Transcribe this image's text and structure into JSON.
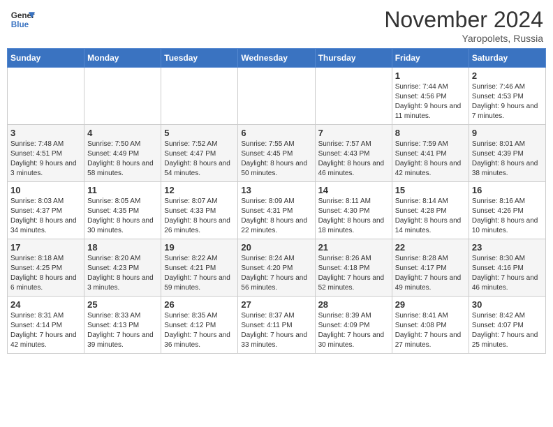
{
  "header": {
    "logo_text_general": "General",
    "logo_text_blue": "Blue",
    "month_title": "November 2024",
    "location": "Yaropolets, Russia"
  },
  "weekdays": [
    "Sunday",
    "Monday",
    "Tuesday",
    "Wednesday",
    "Thursday",
    "Friday",
    "Saturday"
  ],
  "weeks": [
    [
      {
        "day": "",
        "info": ""
      },
      {
        "day": "",
        "info": ""
      },
      {
        "day": "",
        "info": ""
      },
      {
        "day": "",
        "info": ""
      },
      {
        "day": "",
        "info": ""
      },
      {
        "day": "1",
        "info": "Sunrise: 7:44 AM\nSunset: 4:56 PM\nDaylight: 9 hours and 11 minutes."
      },
      {
        "day": "2",
        "info": "Sunrise: 7:46 AM\nSunset: 4:53 PM\nDaylight: 9 hours and 7 minutes."
      }
    ],
    [
      {
        "day": "3",
        "info": "Sunrise: 7:48 AM\nSunset: 4:51 PM\nDaylight: 9 hours and 3 minutes."
      },
      {
        "day": "4",
        "info": "Sunrise: 7:50 AM\nSunset: 4:49 PM\nDaylight: 8 hours and 58 minutes."
      },
      {
        "day": "5",
        "info": "Sunrise: 7:52 AM\nSunset: 4:47 PM\nDaylight: 8 hours and 54 minutes."
      },
      {
        "day": "6",
        "info": "Sunrise: 7:55 AM\nSunset: 4:45 PM\nDaylight: 8 hours and 50 minutes."
      },
      {
        "day": "7",
        "info": "Sunrise: 7:57 AM\nSunset: 4:43 PM\nDaylight: 8 hours and 46 minutes."
      },
      {
        "day": "8",
        "info": "Sunrise: 7:59 AM\nSunset: 4:41 PM\nDaylight: 8 hours and 42 minutes."
      },
      {
        "day": "9",
        "info": "Sunrise: 8:01 AM\nSunset: 4:39 PM\nDaylight: 8 hours and 38 minutes."
      }
    ],
    [
      {
        "day": "10",
        "info": "Sunrise: 8:03 AM\nSunset: 4:37 PM\nDaylight: 8 hours and 34 minutes."
      },
      {
        "day": "11",
        "info": "Sunrise: 8:05 AM\nSunset: 4:35 PM\nDaylight: 8 hours and 30 minutes."
      },
      {
        "day": "12",
        "info": "Sunrise: 8:07 AM\nSunset: 4:33 PM\nDaylight: 8 hours and 26 minutes."
      },
      {
        "day": "13",
        "info": "Sunrise: 8:09 AM\nSunset: 4:31 PM\nDaylight: 8 hours and 22 minutes."
      },
      {
        "day": "14",
        "info": "Sunrise: 8:11 AM\nSunset: 4:30 PM\nDaylight: 8 hours and 18 minutes."
      },
      {
        "day": "15",
        "info": "Sunrise: 8:14 AM\nSunset: 4:28 PM\nDaylight: 8 hours and 14 minutes."
      },
      {
        "day": "16",
        "info": "Sunrise: 8:16 AM\nSunset: 4:26 PM\nDaylight: 8 hours and 10 minutes."
      }
    ],
    [
      {
        "day": "17",
        "info": "Sunrise: 8:18 AM\nSunset: 4:25 PM\nDaylight: 8 hours and 6 minutes."
      },
      {
        "day": "18",
        "info": "Sunrise: 8:20 AM\nSunset: 4:23 PM\nDaylight: 8 hours and 3 minutes."
      },
      {
        "day": "19",
        "info": "Sunrise: 8:22 AM\nSunset: 4:21 PM\nDaylight: 7 hours and 59 minutes."
      },
      {
        "day": "20",
        "info": "Sunrise: 8:24 AM\nSunset: 4:20 PM\nDaylight: 7 hours and 56 minutes."
      },
      {
        "day": "21",
        "info": "Sunrise: 8:26 AM\nSunset: 4:18 PM\nDaylight: 7 hours and 52 minutes."
      },
      {
        "day": "22",
        "info": "Sunrise: 8:28 AM\nSunset: 4:17 PM\nDaylight: 7 hours and 49 minutes."
      },
      {
        "day": "23",
        "info": "Sunrise: 8:30 AM\nSunset: 4:16 PM\nDaylight: 7 hours and 46 minutes."
      }
    ],
    [
      {
        "day": "24",
        "info": "Sunrise: 8:31 AM\nSunset: 4:14 PM\nDaylight: 7 hours and 42 minutes."
      },
      {
        "day": "25",
        "info": "Sunrise: 8:33 AM\nSunset: 4:13 PM\nDaylight: 7 hours and 39 minutes."
      },
      {
        "day": "26",
        "info": "Sunrise: 8:35 AM\nSunset: 4:12 PM\nDaylight: 7 hours and 36 minutes."
      },
      {
        "day": "27",
        "info": "Sunrise: 8:37 AM\nSunset: 4:11 PM\nDaylight: 7 hours and 33 minutes."
      },
      {
        "day": "28",
        "info": "Sunrise: 8:39 AM\nSunset: 4:09 PM\nDaylight: 7 hours and 30 minutes."
      },
      {
        "day": "29",
        "info": "Sunrise: 8:41 AM\nSunset: 4:08 PM\nDaylight: 7 hours and 27 minutes."
      },
      {
        "day": "30",
        "info": "Sunrise: 8:42 AM\nSunset: 4:07 PM\nDaylight: 7 hours and 25 minutes."
      }
    ]
  ]
}
